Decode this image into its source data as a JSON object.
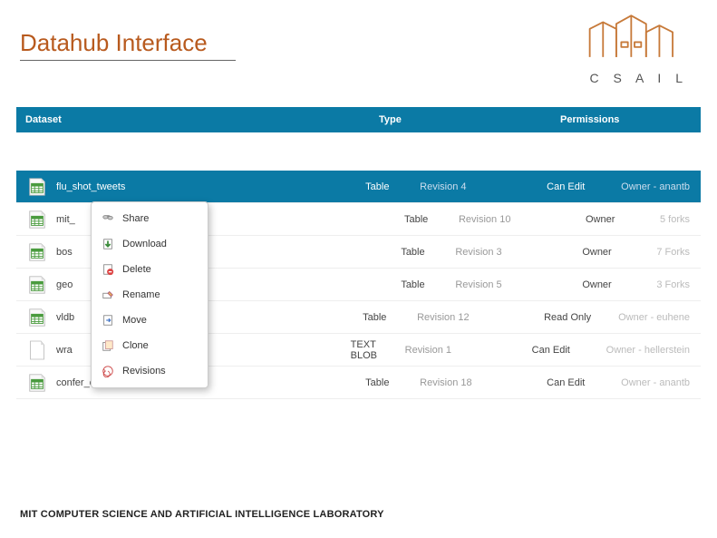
{
  "title": "Datahub Interface",
  "logo_text": "C S A I L",
  "table": {
    "headers": {
      "dataset": "Dataset",
      "type": "Type",
      "permissions": "Permissions"
    },
    "rows": [
      {
        "icon": "table",
        "name": "flu_shot_tweets",
        "type": "Table",
        "revision": "Revision 4",
        "permission": "Can Edit",
        "owner": "Owner - anantb",
        "selected": true
      },
      {
        "icon": "table",
        "name": "mit_",
        "type": "Table",
        "revision": "Revision 10",
        "permission": "Owner",
        "owner": "5 forks",
        "selected": false
      },
      {
        "icon": "table",
        "name": "bos",
        "type": "Table",
        "revision": "Revision 3",
        "permission": "Owner",
        "owner": "7 Forks",
        "selected": false
      },
      {
        "icon": "table",
        "name": "geo",
        "type": "Table",
        "revision": "Revision 5",
        "permission": "Owner",
        "owner": "3 Forks",
        "selected": false
      },
      {
        "icon": "table",
        "name": "vldb",
        "type": "Table",
        "revision": "Revision 12",
        "permission": "Read Only",
        "owner": "Owner - euhene",
        "selected": false
      },
      {
        "icon": "text",
        "name": "wra",
        "type": "TEXT BLOB",
        "revision": "Revision 1",
        "permission": "Can Edit",
        "owner": "Owner - hellerstein",
        "selected": false
      },
      {
        "icon": "table",
        "name": "confer_chi",
        "type": "Table",
        "revision": "Revision 18",
        "permission": "Can Edit",
        "owner": "Owner - anantb",
        "selected": false
      }
    ]
  },
  "context_menu": {
    "items": [
      {
        "icon": "share",
        "label": "Share"
      },
      {
        "icon": "download",
        "label": "Download"
      },
      {
        "icon": "delete",
        "label": "Delete"
      },
      {
        "icon": "rename",
        "label": "Rename"
      },
      {
        "icon": "move",
        "label": "Move"
      },
      {
        "icon": "clone",
        "label": "Clone"
      },
      {
        "icon": "revisions",
        "label": "Revisions"
      }
    ]
  },
  "footer": "MIT COMPUTER SCIENCE AND ARTIFICIAL INTELLIGENCE LABORATORY"
}
